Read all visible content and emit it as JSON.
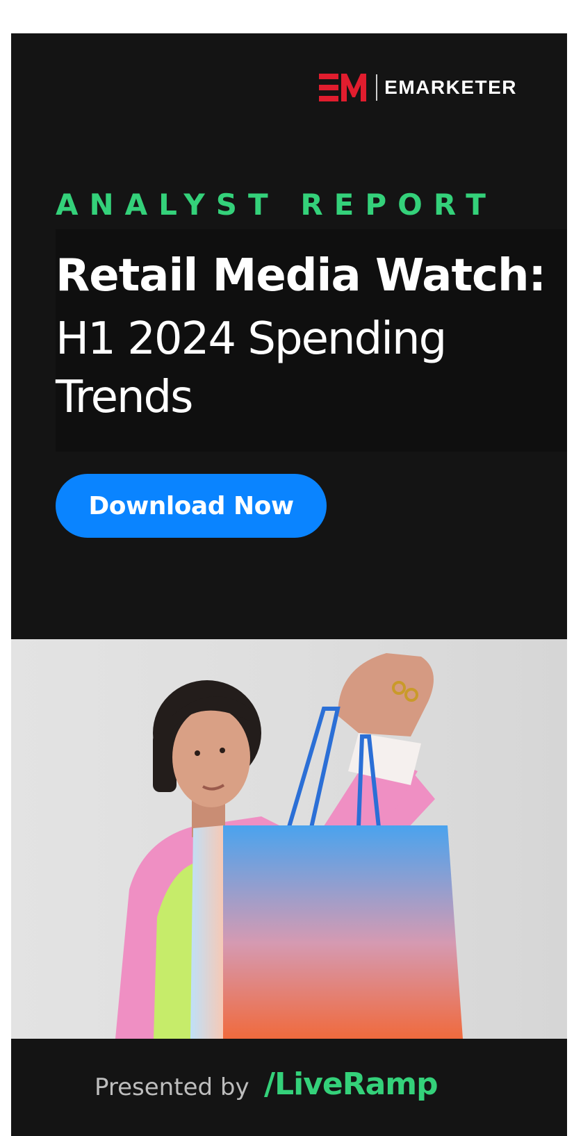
{
  "header": {
    "brand_name": "EMARKETER",
    "logo_icon": "em-logo-icon",
    "brand_color": "#e11d2e"
  },
  "content": {
    "eyebrow": "ANALYST REPORT",
    "title_bold": "Retail Media Watch:",
    "title_light": "H1 2024 Spending Trends",
    "cta_label": "Download Now",
    "accent_color": "#34d17a",
    "cta_color": "#0a84ff"
  },
  "footer": {
    "presented_by": "Presented by",
    "sponsor": "/LiveRamp"
  }
}
